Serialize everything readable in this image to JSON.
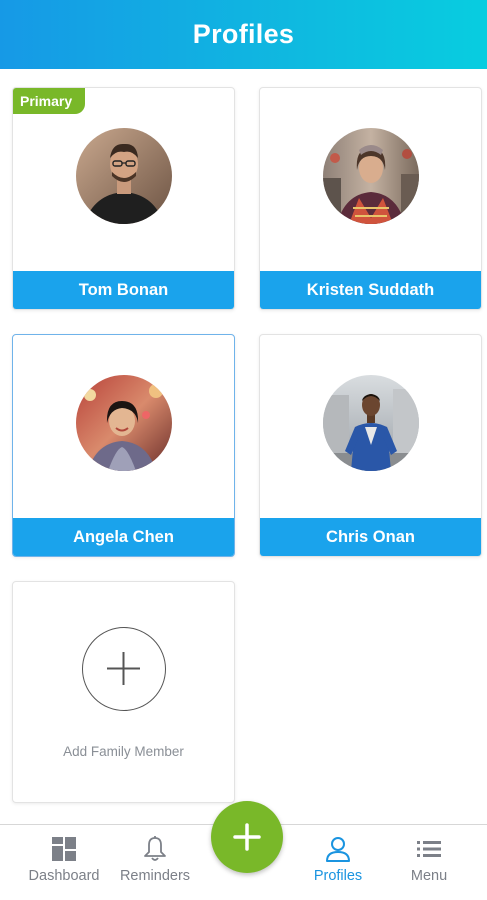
{
  "header": {
    "title": "Profiles"
  },
  "profiles": [
    {
      "name": "Tom Bonan",
      "badge": "Primary"
    },
    {
      "name": "Kristen Suddath"
    },
    {
      "name": "Angela Chen"
    },
    {
      "name": "Chris Onan"
    }
  ],
  "add_member": {
    "label": "Add Family Member"
  },
  "tabbar": {
    "items": [
      {
        "label": "Dashboard",
        "icon": "dashboard-icon"
      },
      {
        "label": "Reminders",
        "icon": "bell-icon"
      },
      {
        "label": "Profiles",
        "icon": "person-icon",
        "active": true
      },
      {
        "label": "Menu",
        "icon": "menu-icon"
      }
    ],
    "fab_icon": "plus-icon"
  },
  "colors": {
    "header_gradient_start": "#1699e6",
    "header_gradient_end": "#08cde0",
    "name_bar": "#1aa3ec",
    "accent_green": "#79b829",
    "active_tab": "#1a94e0"
  }
}
